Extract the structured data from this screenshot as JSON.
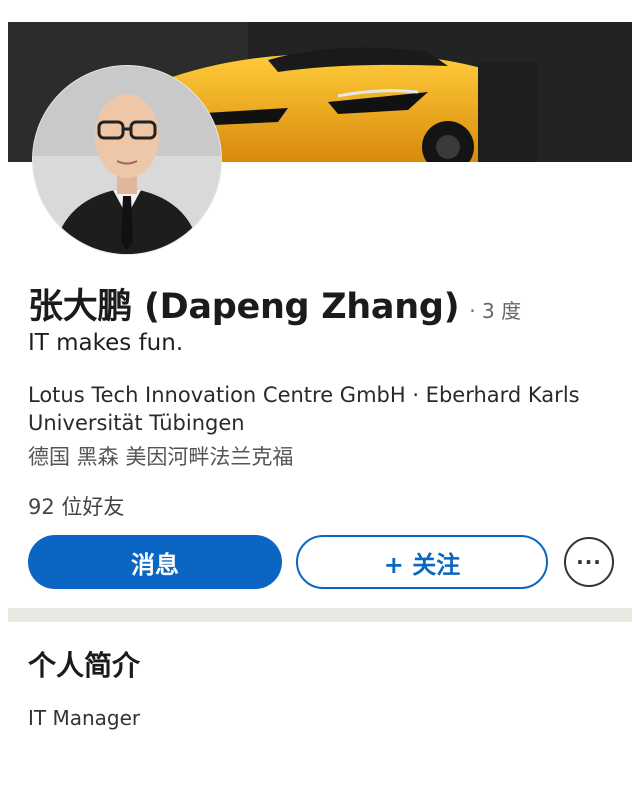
{
  "profile": {
    "name": "张大鹏 (Dapeng Zhang)",
    "degree": "· 3 度",
    "tagline": "IT makes fun.",
    "organizations": "Lotus Tech Innovation Centre GmbH · Eberhard Karls Universität Tübingen",
    "location": "德国 黑森 美因河畔法兰克福",
    "friends": "92 位好友"
  },
  "actions": {
    "message_label": "消息",
    "follow_label": "+ 关注",
    "more_label": "···"
  },
  "about": {
    "title": "个人简介",
    "text": "IT Manager"
  },
  "colors": {
    "accent": "#0a66c2",
    "banner_car": "#f2a81d",
    "divider": "#eae8e2"
  }
}
